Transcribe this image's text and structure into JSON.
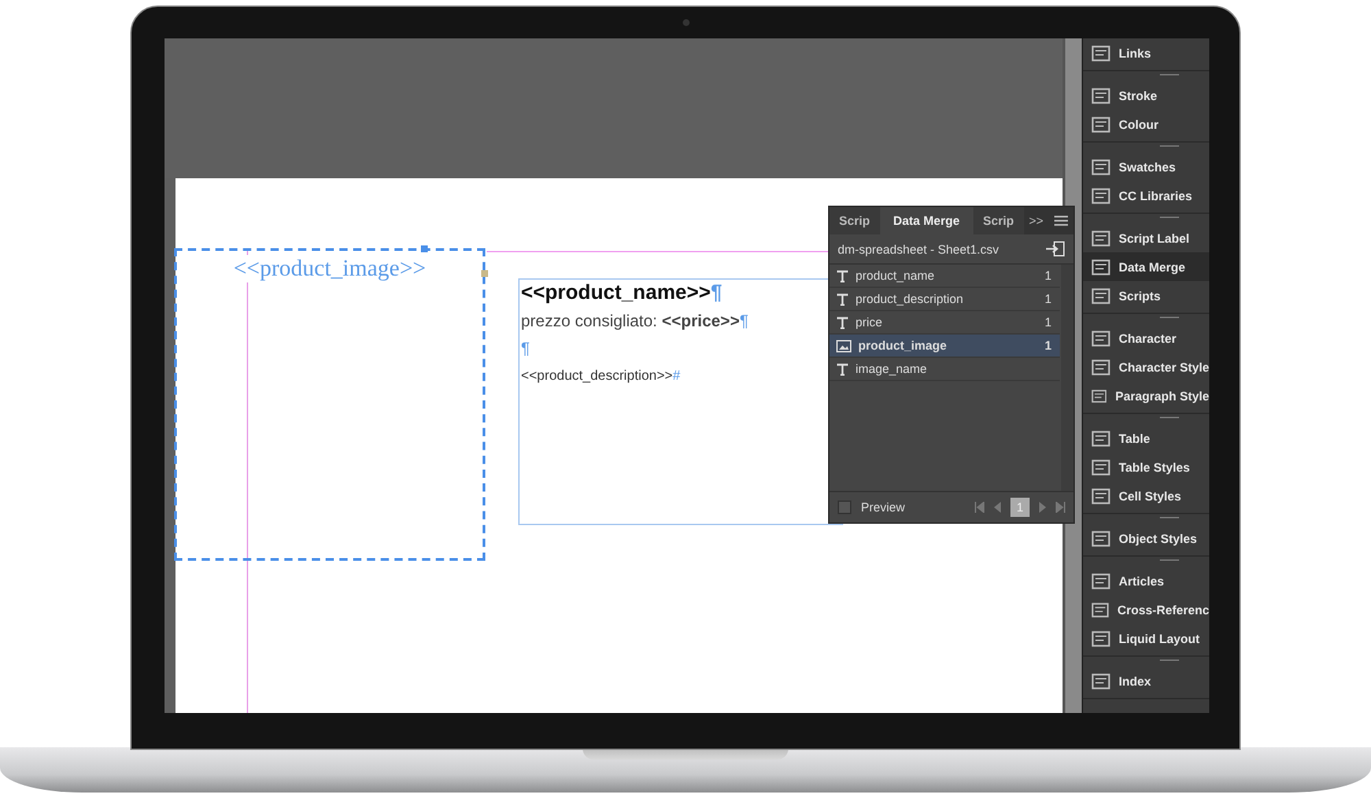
{
  "document": {
    "image_placeholder": "<<product_image>>",
    "text_lines": [
      {
        "text": "<<product_name>>",
        "mark": "¶"
      },
      {
        "text": "prezzo consigliato: **<<price>>**",
        "mark": "¶"
      },
      {
        "mark": "¶"
      },
      {
        "text": "<<product_description>>",
        "mark": "#"
      }
    ]
  },
  "data_merge": {
    "tabs": [
      {
        "label": "Scrip",
        "selected": false
      },
      {
        "label": "Data Merge",
        "selected": true
      },
      {
        "label": "Scrip",
        "selected": false
      }
    ],
    "overflow": ">>",
    "source": "dm-spreadsheet - Sheet1.csv",
    "fields": [
      {
        "kind": "text",
        "name": "product_name",
        "count": "1",
        "selected": false
      },
      {
        "kind": "text",
        "name": "product_description",
        "count": "1",
        "selected": false
      },
      {
        "kind": "text",
        "name": "price",
        "count": "1",
        "selected": false
      },
      {
        "kind": "image",
        "name": "product_image",
        "count": "1",
        "selected": true
      },
      {
        "kind": "text",
        "name": "image_name",
        "selected": false
      }
    ],
    "preview": {
      "label": "Preview",
      "checked": false
    },
    "page": "1"
  },
  "dock": {
    "groups": [
      [
        {
          "label": "Links",
          "selected": false
        }
      ],
      [
        {
          "label": "Stroke",
          "selected": false
        },
        {
          "label": "Colour",
          "selected": false
        }
      ],
      [
        {
          "label": "Swatches",
          "selected": false
        },
        {
          "label": "CC Libraries",
          "selected": false
        }
      ],
      [
        {
          "label": "Script Label",
          "selected": false
        },
        {
          "label": "Data Merge",
          "selected": true
        },
        {
          "label": "Scripts",
          "selected": false
        }
      ],
      [
        {
          "label": "Character",
          "selected": false
        },
        {
          "label": "Character Style",
          "selected": false
        },
        {
          "label": "Paragraph Style",
          "selected": false
        }
      ],
      [
        {
          "label": "Table",
          "selected": false
        },
        {
          "label": "Table Styles",
          "selected": false
        },
        {
          "label": "Cell Styles",
          "selected": false
        }
      ],
      [
        {
          "label": "Object Styles",
          "selected": false
        }
      ],
      [
        {
          "label": "Articles",
          "selected": false
        },
        {
          "label": "Cross-Referenc",
          "selected": false
        },
        {
          "label": "Liquid Layout",
          "selected": false
        }
      ],
      [
        {
          "label": "Index",
          "selected": false
        }
      ]
    ]
  }
}
